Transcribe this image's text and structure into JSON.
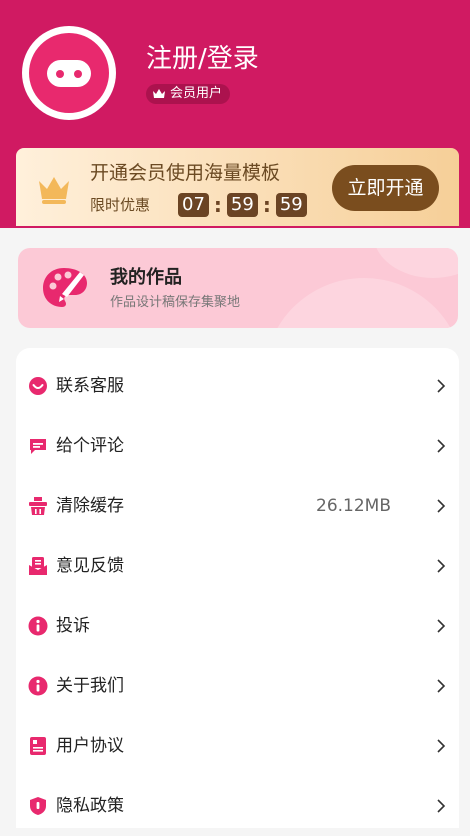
{
  "profile": {
    "login_text": "注册/登录",
    "badge_label": "会员用户"
  },
  "vip": {
    "title": "开通会员使用海量模板",
    "limited_label": "限时优惠",
    "countdown": {
      "hours": "07",
      "minutes": "59",
      "seconds": "59"
    },
    "button_label": "立即开通"
  },
  "works": {
    "title": "我的作品",
    "subtitle": "作品设计稿保存集聚地"
  },
  "menu": {
    "items": [
      {
        "label": "联系客服",
        "icon": "chat-bubble-icon",
        "value": ""
      },
      {
        "label": "给个评论",
        "icon": "comment-icon",
        "value": ""
      },
      {
        "label": "清除缓存",
        "icon": "cleanup-icon",
        "value": "26.12MB"
      },
      {
        "label": "意见反馈",
        "icon": "feedback-icon",
        "value": ""
      },
      {
        "label": "投诉",
        "icon": "info-icon",
        "value": ""
      },
      {
        "label": "关于我们",
        "icon": "info-icon",
        "value": ""
      },
      {
        "label": "用户协议",
        "icon": "document-icon",
        "value": ""
      },
      {
        "label": "隐私政策",
        "icon": "shield-icon",
        "value": ""
      }
    ]
  },
  "colors": {
    "brand": "#d01a62",
    "icon_pink": "#e8296e",
    "vip_brown": "#7a4d1e"
  }
}
